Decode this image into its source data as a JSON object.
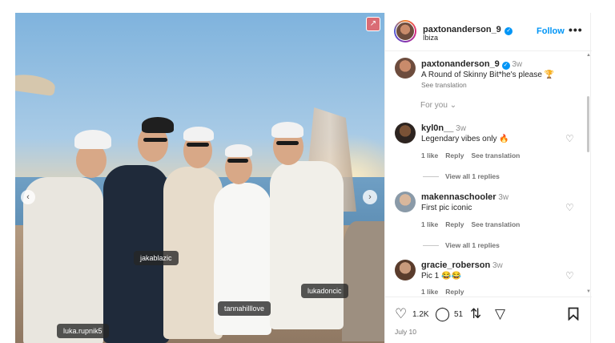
{
  "post": {
    "author": "paxtonanderson_9",
    "location": "Ibiza",
    "follow_label": "Follow",
    "more_label": "•••",
    "date": "July 10"
  },
  "photo": {
    "tags": [
      "jakablazic",
      "lukadoncic",
      "tannahilllove",
      "luka.rupnik5"
    ],
    "prev_icon": "chevron-left-icon",
    "next_icon": "chevron-right-icon",
    "expand_icon": "external-link-icon"
  },
  "caption": {
    "author": "paxtonanderson_9",
    "time": "3w",
    "text": "A Round of Skinny Bit*he's please 🏆",
    "see_translation": "See translation",
    "for_you": "For you"
  },
  "comments": [
    {
      "user": "kyl0n__",
      "time": "3w",
      "text": "Legendary vibes only 🔥",
      "likes": "1 like",
      "reply": "Reply",
      "translate": "See translation",
      "view_replies": "View all 1 replies"
    },
    {
      "user": "makennaschooler",
      "time": "3w",
      "text": "First pic iconic",
      "likes": "1 like",
      "reply": "Reply",
      "translate": "See translation",
      "view_replies": "View all 1 replies"
    },
    {
      "user": "gracie_roberson",
      "time": "3w",
      "text": "Pic 1 😂😂",
      "likes": "1 like",
      "reply": "Reply"
    }
  ],
  "actions": {
    "likes_count": "1.2K",
    "comments_count": "51"
  },
  "colors": {
    "accent": "#0095f6",
    "text": "#262626",
    "muted": "#737373"
  }
}
